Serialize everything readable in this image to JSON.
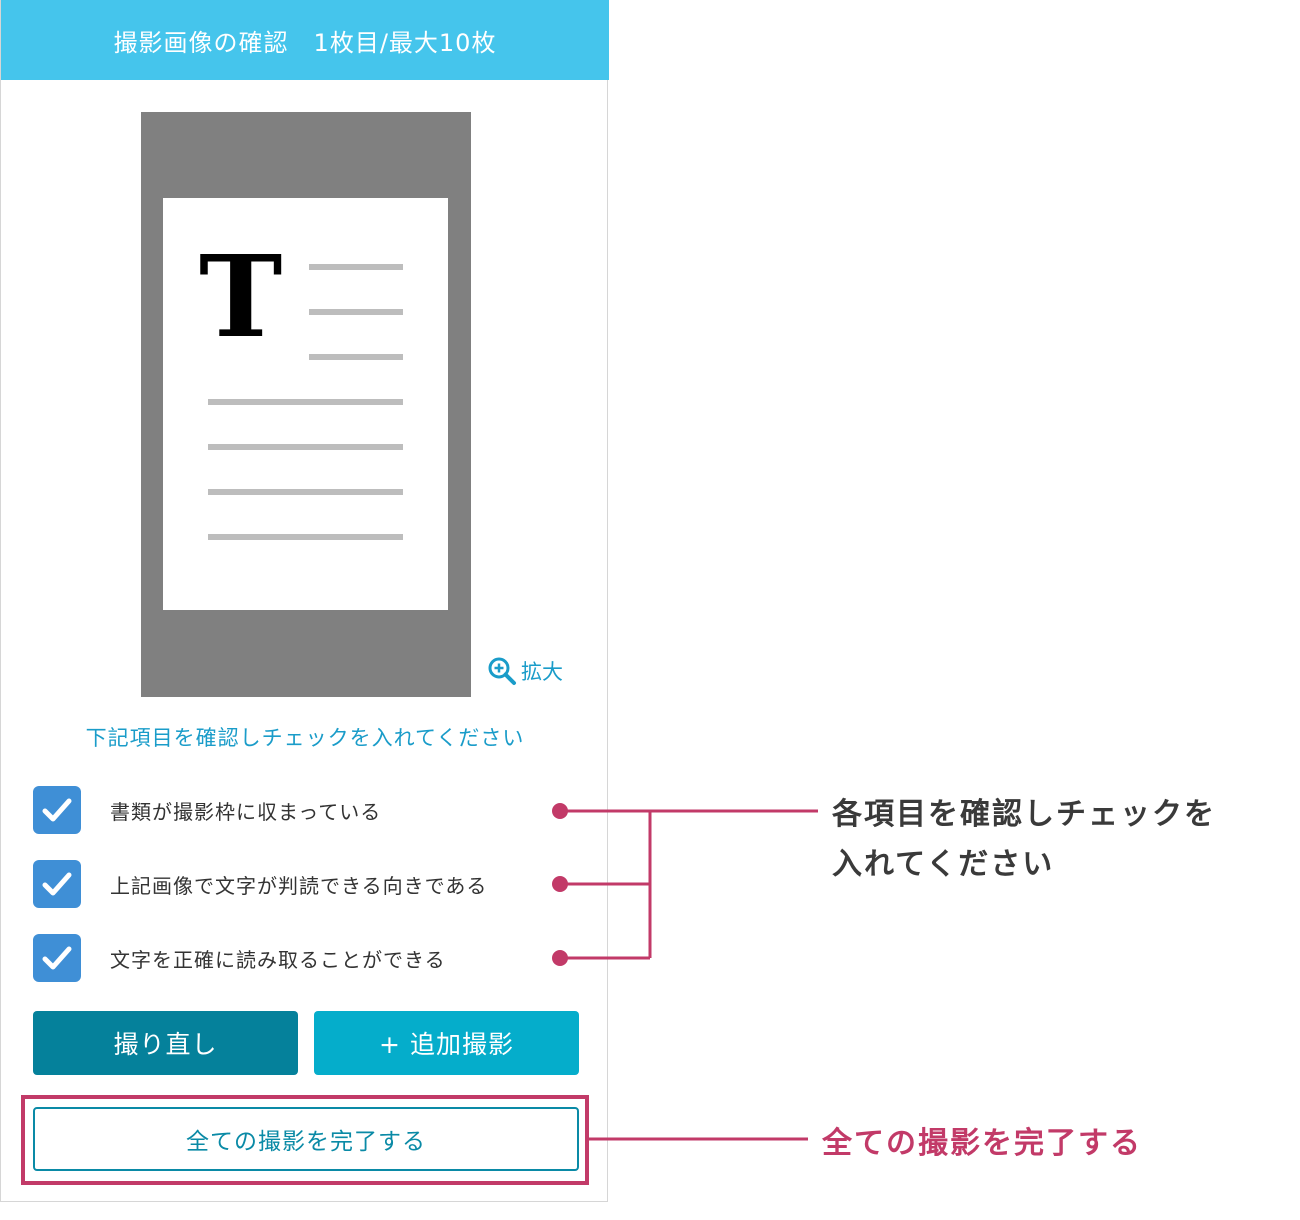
{
  "header": {
    "title": "撮影画像の確認　1枚目/最大10枚"
  },
  "preview": {
    "letter": "T"
  },
  "zoom": {
    "label": "拡大",
    "icon": "zoom-in-icon"
  },
  "instruction": "下記項目を確認しチェックを入れてください",
  "checklist": [
    {
      "label": "書類が撮影枠に収まっている",
      "checked": true
    },
    {
      "label": "上記画像で文字が判読できる向きである",
      "checked": true
    },
    {
      "label": "文字を正確に読み取ることができる",
      "checked": true
    }
  ],
  "buttons": {
    "retake": "撮り直し",
    "add": "+ 追加撮影",
    "complete": "全ての撮影を完了する"
  },
  "annotations": {
    "checklist_line1": "各項目を確認しチェックを",
    "checklist_line2": "入れてください",
    "complete": "全ての撮影を完了する"
  },
  "colors": {
    "header": "#45c5ec",
    "accent_text": "#1a9cc9",
    "checkbox": "#3f8fd6",
    "retake_button": "#05819b",
    "add_button": "#05adcb",
    "annotation": "#c23a68"
  }
}
